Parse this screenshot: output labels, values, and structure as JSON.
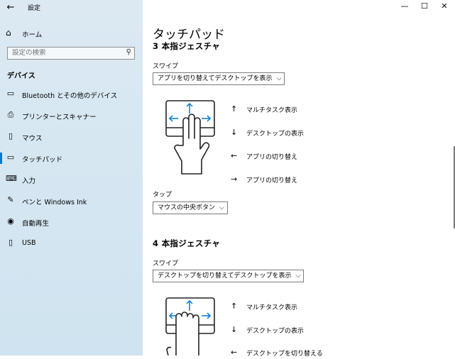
{
  "app": {
    "title": "設定"
  },
  "sidebar": {
    "home_label": "ホーム",
    "search_placeholder": "設定の検索",
    "section": "デバイス",
    "items": [
      {
        "label": "Bluetooth とその他のデバイス",
        "icon": "bluetooth-icon"
      },
      {
        "label": "プリンターとスキャナー",
        "icon": "printer-icon"
      },
      {
        "label": "マウス",
        "icon": "mouse-icon"
      },
      {
        "label": "タッチパッド",
        "icon": "touchpad-icon",
        "active": true
      },
      {
        "label": "入力",
        "icon": "keyboard-icon"
      },
      {
        "label": "ペンと Windows Ink",
        "icon": "pen-icon"
      },
      {
        "label": "自動再生",
        "icon": "autoplay-icon"
      },
      {
        "label": "USB",
        "icon": "usb-icon"
      }
    ]
  },
  "main": {
    "title": "タッチパッド",
    "three_finger": {
      "heading": "3 本指ジェスチャ",
      "swipe_label": "スワイプ",
      "swipe_value": "アプリを切り替えてデスクトップを表示",
      "gestures": [
        {
          "arrow": "↑",
          "label": "マルチタスク表示"
        },
        {
          "arrow": "↓",
          "label": "デスクトップの表示"
        },
        {
          "arrow": "←",
          "label": "アプリの切り替え"
        },
        {
          "arrow": "→",
          "label": "アプリの切り替え"
        }
      ],
      "tap_label": "タップ",
      "tap_value": "マウスの中央ボタン"
    },
    "four_finger": {
      "heading": "4 本指ジェスチャ",
      "swipe_label": "スワイプ",
      "swipe_value": "デスクトップを切り替えてデスクトップを表示",
      "gestures": [
        {
          "arrow": "↑",
          "label": "マルチタスク表示"
        },
        {
          "arrow": "↓",
          "label": "デスクトップの表示"
        },
        {
          "arrow": "←",
          "label": "デスクトップを切り替える"
        }
      ]
    }
  },
  "colors": {
    "accent": "#0078d7",
    "sidebar_bg": "#d6e7f2"
  }
}
